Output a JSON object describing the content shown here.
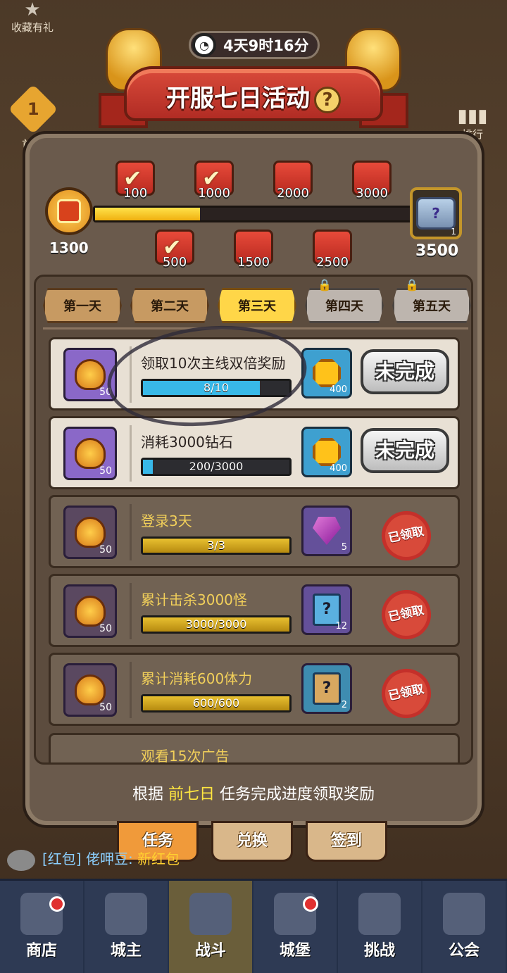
{
  "sidebar": {
    "favorite_label": "收藏有礼",
    "first_charge_label": "首充",
    "first_charge_badge": "1",
    "rank_label": "排行"
  },
  "header": {
    "timer": "4天9时16分",
    "title": "开服七日活动",
    "help": "?"
  },
  "milestones": {
    "current_points": "1300",
    "progress_fraction": 0.33,
    "chests": [
      {
        "label": "100",
        "claimed": true
      },
      {
        "label": "500",
        "claimed": true
      },
      {
        "label": "1000",
        "claimed": true
      },
      {
        "label": "1500",
        "claimed": false
      },
      {
        "label": "2000",
        "claimed": false
      },
      {
        "label": "2500",
        "claimed": false
      },
      {
        "label": "3000",
        "claimed": false
      }
    ],
    "final_chest": {
      "label": "3500",
      "qty": "1",
      "icon": "?"
    }
  },
  "day_tabs": [
    {
      "label": "第一天",
      "state": "normal"
    },
    {
      "label": "第二天",
      "state": "normal"
    },
    {
      "label": "第三天",
      "state": "active"
    },
    {
      "label": "第四天",
      "state": "locked"
    },
    {
      "label": "第五天",
      "state": "locked"
    }
  ],
  "tasks": [
    {
      "name": "领取10次主线双倍奖励",
      "points": "50",
      "progress": "8/10",
      "fraction": 0.8,
      "reward_icon": "coin-icon",
      "reward_qty": "400",
      "status": "未完成",
      "done": false
    },
    {
      "name": "消耗3000钻石",
      "points": "50",
      "progress": "200/3000",
      "fraction": 0.067,
      "reward_icon": "coin-icon",
      "reward_qty": "400",
      "status": "未完成",
      "done": false
    },
    {
      "name": "登录3天",
      "points": "50",
      "progress": "3/3",
      "fraction": 1.0,
      "reward_icon": "gem-icon",
      "reward_qty": "5",
      "status": "已领取",
      "done": true
    },
    {
      "name": "累计击杀3000怪",
      "points": "50",
      "progress": "3000/3000",
      "fraction": 1.0,
      "reward_icon": "puzzle-card-icon",
      "reward_qty": "12",
      "status": "已领取",
      "done": true
    },
    {
      "name": "累计消耗600体力",
      "points": "50",
      "progress": "600/600",
      "fraction": 1.0,
      "reward_icon": "mystery-scroll-icon",
      "reward_qty": "2",
      "status": "已领取",
      "done": true
    }
  ],
  "partial_task": {
    "name": "观看15次广告"
  },
  "footer": {
    "tip_prefix": "根据 ",
    "tip_highlight": "前七日",
    "tip_suffix": " 任务完成进度领取奖励"
  },
  "bottom_tabs": [
    {
      "label": "任务",
      "active": true
    },
    {
      "label": "兑换",
      "active": false
    },
    {
      "label": "签到",
      "active": false
    }
  ],
  "chat": {
    "prefix": "[红包] 佬呷豆: ",
    "gift": "新红包"
  },
  "nav": [
    {
      "label": "商店",
      "dot": true
    },
    {
      "label": "城主",
      "dot": false
    },
    {
      "label": "战斗",
      "dot": false,
      "active": true
    },
    {
      "label": "城堡",
      "dot": true
    },
    {
      "label": "挑战",
      "dot": false
    },
    {
      "label": "公会",
      "dot": false
    }
  ],
  "colors": {
    "accent": "#ffd648",
    "progress_blue": "#38b8e8",
    "claimed_red": "#d84a3a"
  }
}
